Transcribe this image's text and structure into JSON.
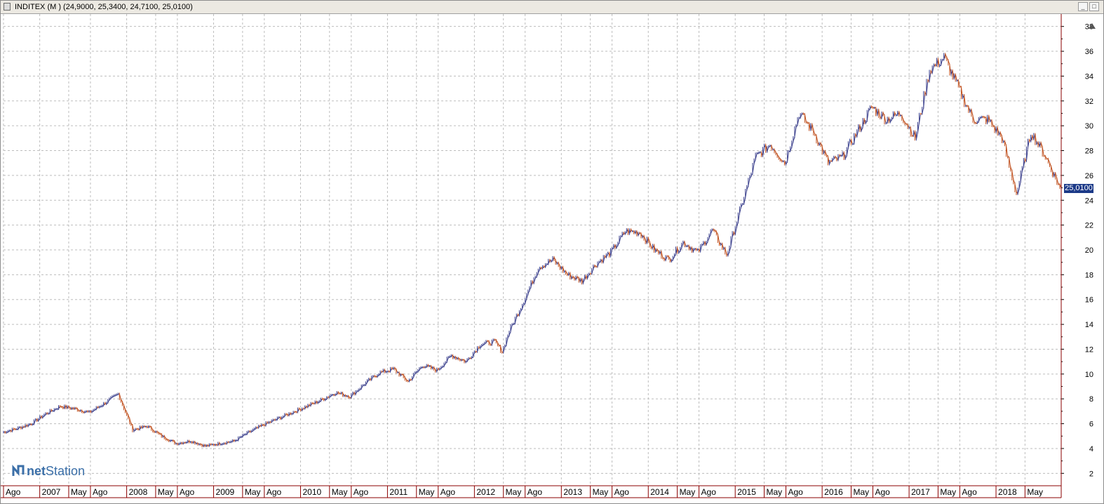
{
  "window": {
    "title": "INDITEX (M ) (24,9000, 25,3400, 24,7100, 25,0100)"
  },
  "logo": {
    "net": "net",
    "station": "Station"
  },
  "price_tag": "25,0100",
  "colors": {
    "up": "#3a3f8c",
    "down": "#c0501e",
    "grid": "#bdbdbd",
    "axis": "#8b0000",
    "tag": "#1c3a88"
  },
  "icons": {
    "minimize": "minimize-icon",
    "maximize": "maximize-icon",
    "scroll": "scroll-up-icon",
    "logo": "netstation-logo-icon"
  },
  "chart_data": {
    "type": "line",
    "title": "",
    "xlabel": "",
    "ylabel": "",
    "ylim": [
      1,
      39
    ],
    "yticks": [
      2,
      4,
      6,
      8,
      10,
      12,
      14,
      16,
      18,
      20,
      22,
      24,
      26,
      28,
      30,
      32,
      34,
      36,
      38
    ],
    "grid": true,
    "x_labels": [
      "Ago",
      "2007",
      "May",
      "Ago",
      "2008",
      "May",
      "Ago",
      "2009",
      "May",
      "Ago",
      "2010",
      "May",
      "Ago",
      "2011",
      "May",
      "Ago",
      "2012",
      "May",
      "Ago",
      "2013",
      "May",
      "Ago",
      "2014",
      "May",
      "Ago",
      "2015",
      "May",
      "Ago",
      "2016",
      "May",
      "Ago",
      "2017",
      "May",
      "Ago",
      "2018",
      "May"
    ],
    "x_tick_dates": [
      "2006-08",
      "2007-01",
      "2007-05",
      "2007-08",
      "2008-01",
      "2008-05",
      "2008-08",
      "2009-01",
      "2009-05",
      "2009-08",
      "2010-01",
      "2010-05",
      "2010-08",
      "2011-01",
      "2011-05",
      "2011-08",
      "2012-01",
      "2012-05",
      "2012-08",
      "2013-01",
      "2013-05",
      "2013-08",
      "2014-01",
      "2014-05",
      "2014-08",
      "2015-01",
      "2015-05",
      "2015-08",
      "2016-01",
      "2016-05",
      "2016-08",
      "2017-01",
      "2017-05",
      "2017-08",
      "2018-01",
      "2018-05"
    ],
    "series": [
      {
        "x": [
          "2006-08",
          "2006-10",
          "2006-12",
          "2007-02",
          "2007-04",
          "2007-06",
          "2007-08",
          "2007-10",
          "2007-12",
          "2008-02",
          "2008-04",
          "2008-06",
          "2008-08",
          "2008-10",
          "2008-12",
          "2009-02",
          "2009-04",
          "2009-06",
          "2009-08",
          "2009-10",
          "2009-12",
          "2010-02",
          "2010-04",
          "2010-06",
          "2010-08",
          "2010-10",
          "2010-12",
          "2011-02",
          "2011-04",
          "2011-06",
          "2011-08",
          "2011-10",
          "2011-12",
          "2012-02",
          "2012-04",
          "2012-05",
          "2012-06",
          "2012-08",
          "2012-10",
          "2012-12",
          "2013-02",
          "2013-04",
          "2013-06",
          "2013-08",
          "2013-10",
          "2013-12",
          "2014-02",
          "2014-04",
          "2014-06",
          "2014-08",
          "2014-10",
          "2014-12",
          "2015-02",
          "2015-04",
          "2015-06",
          "2015-08",
          "2015-10",
          "2015-12",
          "2016-02",
          "2016-04",
          "2016-06",
          "2016-08",
          "2016-10",
          "2016-12",
          "2017-02",
          "2017-04",
          "2017-06",
          "2017-08",
          "2017-10",
          "2017-12",
          "2018-02",
          "2018-04",
          "2018-06",
          "2018-08",
          "2018-10"
        ],
        "values": [
          5.3,
          5.6,
          6.0,
          6.8,
          7.4,
          7.2,
          6.9,
          7.6,
          8.4,
          5.5,
          5.8,
          5.0,
          4.4,
          4.6,
          4.2,
          4.4,
          4.6,
          5.3,
          5.9,
          6.4,
          6.9,
          7.4,
          7.9,
          8.5,
          8.2,
          9.2,
          10.1,
          10.4,
          9.4,
          10.7,
          10.3,
          11.5,
          11.0,
          12.4,
          12.6,
          11.8,
          13.5,
          15.9,
          18.6,
          19.2,
          18.0,
          17.5,
          18.9,
          19.8,
          21.5,
          21.4,
          20.0,
          19.2,
          20.6,
          19.8,
          21.6,
          19.6,
          23.5,
          27.5,
          28.5,
          27.0,
          31.0,
          29.5,
          27.0,
          27.5,
          29.5,
          31.5,
          30.5,
          31.0,
          29.0,
          34.5,
          35.5,
          33.0,
          30.5,
          30.5,
          29.0,
          24.5,
          29.5,
          27.5,
          25.0
        ]
      }
    ]
  }
}
